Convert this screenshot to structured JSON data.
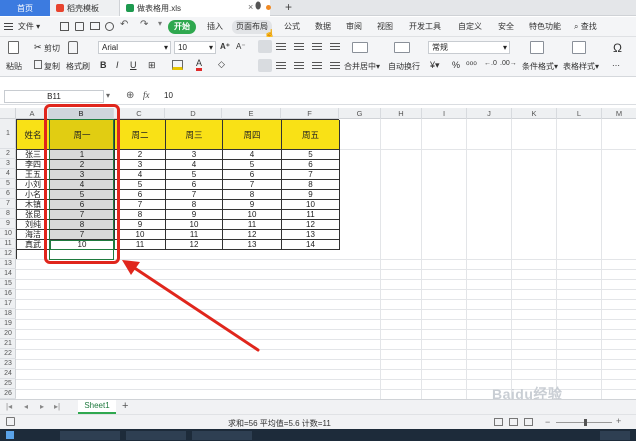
{
  "window_tabs": {
    "home": "首页",
    "template": "稻壳模板",
    "document": "做表格用.xls",
    "add": "+"
  },
  "menu": {
    "file": "文件",
    "start": "开始",
    "items": [
      "插入",
      "页面布局",
      "公式",
      "数据",
      "审阅",
      "视图",
      "开发工具",
      "自定义",
      "安全",
      "特色功能"
    ],
    "search": "查找"
  },
  "ribbon": {
    "paste": "粘贴",
    "cut": "剪切",
    "copy": "复制",
    "format_painter": "格式刷",
    "font_name": "Arial",
    "font_size": "10",
    "merge_center": "合并居中",
    "wrap_text": "自动换行",
    "number_format": "常规",
    "conditional_format": "条件格式",
    "table_style": "表格样式"
  },
  "formula_bar": {
    "name_box": "B11",
    "fx": "fx",
    "value": "10"
  },
  "columns": [
    "A",
    "B",
    "C",
    "D",
    "E",
    "F",
    "G",
    "H",
    "I",
    "J",
    "K",
    "L",
    "M"
  ],
  "rows": [
    "1",
    "2",
    "3",
    "4",
    "5",
    "6",
    "7",
    "8",
    "9",
    "10",
    "11",
    "12",
    "13",
    "14",
    "15",
    "16",
    "17",
    "18",
    "19",
    "20",
    "21",
    "22",
    "23",
    "24",
    "25",
    "26",
    "27"
  ],
  "table": {
    "headers": [
      "姓名",
      "周一",
      "周二",
      "周三",
      "周四",
      "周五"
    ],
    "body": [
      [
        "张三",
        "1",
        "2",
        "3",
        "4",
        "5"
      ],
      [
        "李四",
        "2",
        "3",
        "4",
        "5",
        "6"
      ],
      [
        "王五",
        "3",
        "4",
        "5",
        "6",
        "7"
      ],
      [
        "小刘",
        "4",
        "5",
        "6",
        "7",
        "8"
      ],
      [
        "小名",
        "5",
        "6",
        "7",
        "8",
        "9"
      ],
      [
        "木镇",
        "6",
        "7",
        "8",
        "9",
        "10"
      ],
      [
        "张昆",
        "7",
        "8",
        "9",
        "10",
        "11"
      ],
      [
        "刘纯",
        "8",
        "9",
        "10",
        "11",
        "12"
      ],
      [
        "海洁",
        "7",
        "10",
        "11",
        "12",
        "13"
      ],
      [
        "真武",
        "10",
        "11",
        "12",
        "13",
        "14"
      ]
    ]
  },
  "sheet_tab": "Sheet1",
  "status": "求和=56  平均值=5.6  计数=11",
  "watermark": "Baidu经验",
  "colors": {
    "header_fill": "#f9e116",
    "selection_fill": "#d9d9d9",
    "annotation": "#e0261c",
    "start_button": "#2fa84f"
  }
}
